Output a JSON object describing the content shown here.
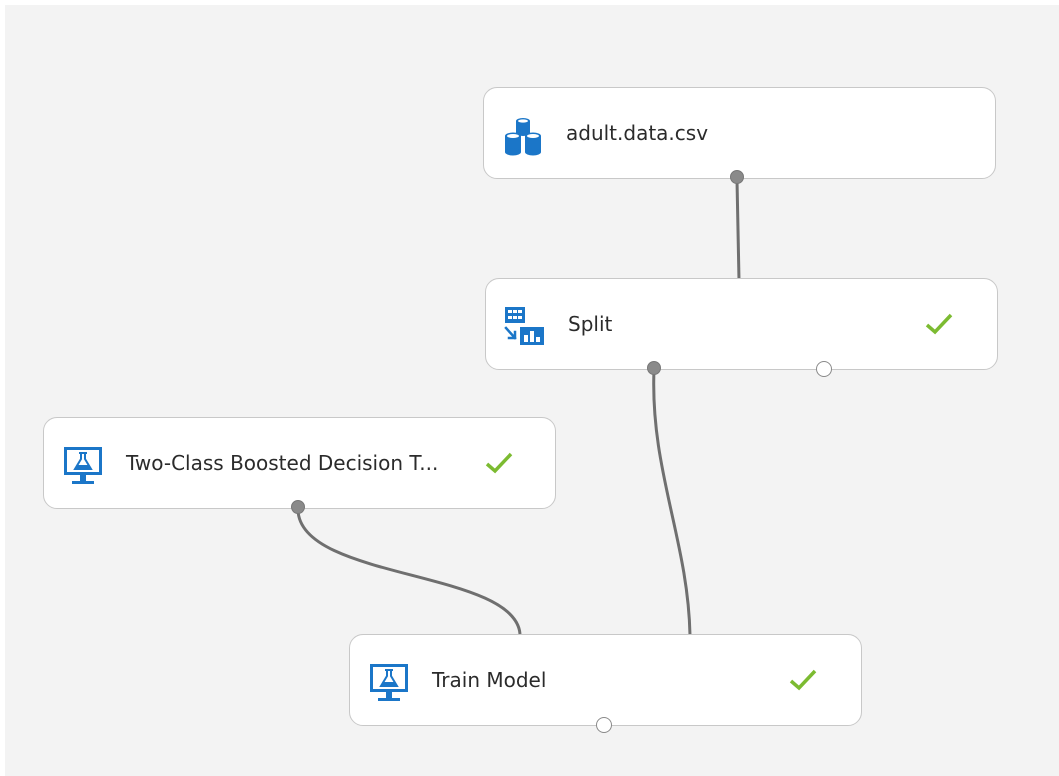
{
  "canvas": {
    "modules": {
      "dataset": {
        "label": "adult.data.csv",
        "icon": "dataset-icon",
        "status": ""
      },
      "split": {
        "label": "Split",
        "icon": "split-data-icon",
        "status": "completed"
      },
      "boosted_tree": {
        "label": "Two-Class Boosted Decision T...",
        "icon": "machine-learning-model-icon",
        "status": "completed"
      },
      "train_model": {
        "label": "Train Model",
        "icon": "machine-learning-model-icon",
        "status": "completed"
      }
    }
  },
  "colors": {
    "canvas_bg": "#f3f3f3",
    "module_bg": "#ffffff",
    "module_border": "#c8c8c8",
    "icon_blue": "#1b76c8",
    "check_green": "#7cbb31",
    "connector": "#6f6f6f"
  }
}
